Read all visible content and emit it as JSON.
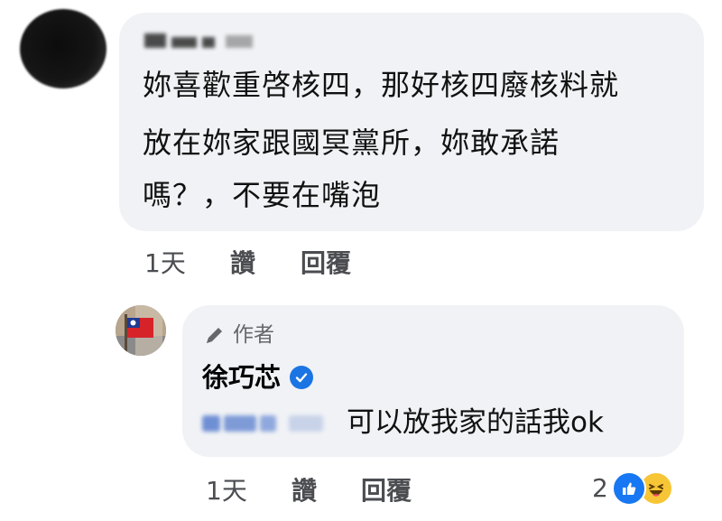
{
  "comment": {
    "lines": [
      "妳喜歡重啓核四，那好核四廢核料就",
      "放在妳家跟國冥黨所，妳敢承諾",
      "嗎？，不要在嘴泡"
    ],
    "time": "1天",
    "like_label": "讚",
    "reply_label": "回覆"
  },
  "reply": {
    "author_badge": "作者",
    "name": "徐巧芯",
    "text": "可以放我家的話我ok",
    "time": "1天",
    "like_label": "讚",
    "reply_label": "回覆",
    "reaction_count": "2",
    "reaction_icons": [
      "like-icon",
      "haha-icon"
    ]
  },
  "colors": {
    "bubble": "#f0f2f5",
    "meta_text": "#4b4d51",
    "verified_blue": "#1b74e4",
    "like_blue": "#1877f2",
    "haha_yellow": "#f7c636"
  }
}
